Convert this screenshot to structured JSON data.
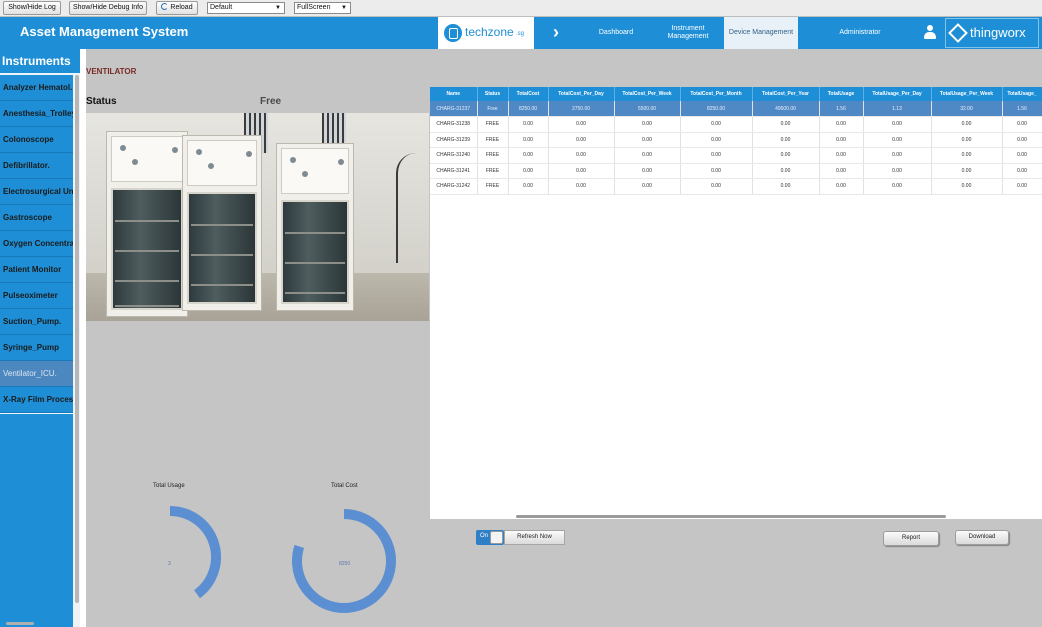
{
  "toolbar": {
    "show_hide_log": "Show/Hide Log",
    "show_hide_debug": "Show/Hide Debug Info",
    "reload": "Reload",
    "mashup_select": "Default",
    "mode_select": "FullScreen"
  },
  "header": {
    "app_title": "Asset Management System",
    "brand_logo_text": "techzone",
    "brand_logo_suffix": ".sg",
    "nav": [
      {
        "label": "Dashboard"
      },
      {
        "label": "Instrument Management"
      },
      {
        "label": "Device Management",
        "active": true
      },
      {
        "label": "Administrator"
      }
    ],
    "platform_logo_text": "thingworx",
    "colors": {
      "header_blue": "#1e8fd6",
      "active_tab": "#e8f1f8"
    }
  },
  "sidebar": {
    "title": "Instruments",
    "items": [
      {
        "label": "Analyzer Hematol..."
      },
      {
        "label": "Anesthesia_Trolley"
      },
      {
        "label": "Colonoscope"
      },
      {
        "label": "Defibrillator."
      },
      {
        "label": "Electrosurgical Unit"
      },
      {
        "label": "Gastroscope"
      },
      {
        "label": "Oxygen Concentra..."
      },
      {
        "label": "Patient Monitor"
      },
      {
        "label": "Pulseoximeter"
      },
      {
        "label": "Suction_Pump."
      },
      {
        "label": "Syringe_Pump"
      },
      {
        "label": "Ventilator_ICU.",
        "selected": true
      },
      {
        "label": "X-Ray Film Proces..."
      }
    ]
  },
  "content": {
    "section_title": "VENTILATOR",
    "status_label": "Status",
    "status_value": "Free"
  },
  "table": {
    "columns": [
      "Name",
      "Status",
      "TotalCost",
      "TotalCost_Per_Day",
      "TotalCost_Per_Week",
      "TotalCost_Per_Month",
      "TotalCost_Per_Year",
      "TotalUsage",
      "TotalUsage_Per_Day",
      "TotalUsage_Per_Week",
      "TotalUsage_"
    ],
    "rows": [
      [
        "CHARG-31237",
        "Free",
        "8250.00",
        "2750.00",
        "5500.00",
        "8250.00",
        "49500.00",
        "1.56",
        "1.13",
        "32.00",
        "1.56"
      ],
      [
        "CHARG-31238",
        "FREE",
        "0.00",
        "0.00",
        "0.00",
        "0.00",
        "0.00",
        "0.00",
        "0.00",
        "0.00",
        "0.00"
      ],
      [
        "CHARG-31239",
        "FREE",
        "0.00",
        "0.00",
        "0.00",
        "0.00",
        "0.00",
        "0.00",
        "0.00",
        "0.00",
        "0.00"
      ],
      [
        "CHARG-31240",
        "FREE",
        "0.00",
        "0.00",
        "0.00",
        "0.00",
        "0.00",
        "0.00",
        "0.00",
        "0.00",
        "0.00"
      ],
      [
        "CHARG-31241",
        "FREE",
        "0.00",
        "0.00",
        "0.00",
        "0.00",
        "0.00",
        "0.00",
        "0.00",
        "0.00",
        "0.00"
      ],
      [
        "CHARG-31242",
        "FREE",
        "0.00",
        "0.00",
        "0.00",
        "0.00",
        "0.00",
        "0.00",
        "0.00",
        "0.00",
        "0.00"
      ]
    ]
  },
  "controls": {
    "toggle_state": "On",
    "refresh_label": "Refresh Now",
    "report_label": "Report",
    "download_label": "Download"
  },
  "gauges": [
    {
      "title": "Total Usage",
      "value": "3",
      "fill_fraction": 0.4
    },
    {
      "title": "Total Cost",
      "value": "8250",
      "fill_fraction": 0.8
    }
  ]
}
